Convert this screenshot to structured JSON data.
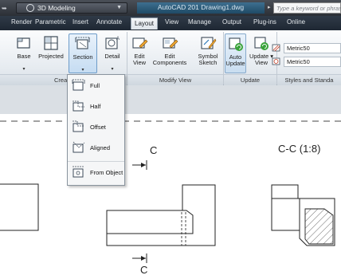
{
  "titlebar": {
    "workspace": "3D Modeling",
    "app_name": "AutoCAD 201",
    "separator": "  ",
    "document": "Drawing1.dwg",
    "search_placeholder": "Type a keyword or phrase"
  },
  "tabs": [
    "Render",
    "Parametric",
    "Insert",
    "Annotate",
    "Layout",
    "View",
    "Manage",
    "Output",
    "Plug-ins",
    "Online"
  ],
  "active_tab": "Layout",
  "ribbon": {
    "create_buttons": [
      {
        "label": "Base",
        "icon": "base-view-icon"
      },
      {
        "label": "Projected",
        "icon": "projected-view-icon"
      },
      {
        "label": "Section",
        "icon": "section-view-icon"
      },
      {
        "label": "Detail",
        "icon": "detail-view-icon"
      }
    ],
    "modify_buttons": [
      {
        "label_line1": "Edit",
        "label_line2": "View",
        "icon": "edit-view-icon"
      },
      {
        "label_line1": "Edit",
        "label_line2": "Components",
        "icon": "edit-components-icon"
      },
      {
        "label_line1": "Symbol",
        "label_line2": "Sketch",
        "icon": "symbol-sketch-icon"
      }
    ],
    "update_buttons": [
      {
        "label_line1": "Auto",
        "label_line2": "Update",
        "icon": "auto-update-icon"
      },
      {
        "label_line1": "Update",
        "label_line2": "View",
        "icon": "update-view-icon"
      }
    ],
    "styles": [
      "Metric50",
      "Metric50"
    ],
    "panels": {
      "create": "Crea",
      "modify": "Modify View",
      "update": "Update",
      "styles": "Styles and Standa"
    }
  },
  "section_menu": [
    {
      "label": "Full",
      "icon": "full-section-icon"
    },
    {
      "label": "Half",
      "icon": "half-section-icon"
    },
    {
      "label": "Offset",
      "icon": "offset-section-icon"
    },
    {
      "label": "Aligned",
      "icon": "aligned-section-icon"
    },
    {
      "label": "From Object",
      "icon": "from-object-section-icon"
    }
  ],
  "drawing": {
    "cut_label_top": "C",
    "cut_label_bottom": "C",
    "section_title": "C-C",
    "section_scale": "(1:8)"
  },
  "colors": {
    "active_blue": "#6e9cc9",
    "titlebar": "#2b2f36",
    "hatch": "#333333"
  }
}
